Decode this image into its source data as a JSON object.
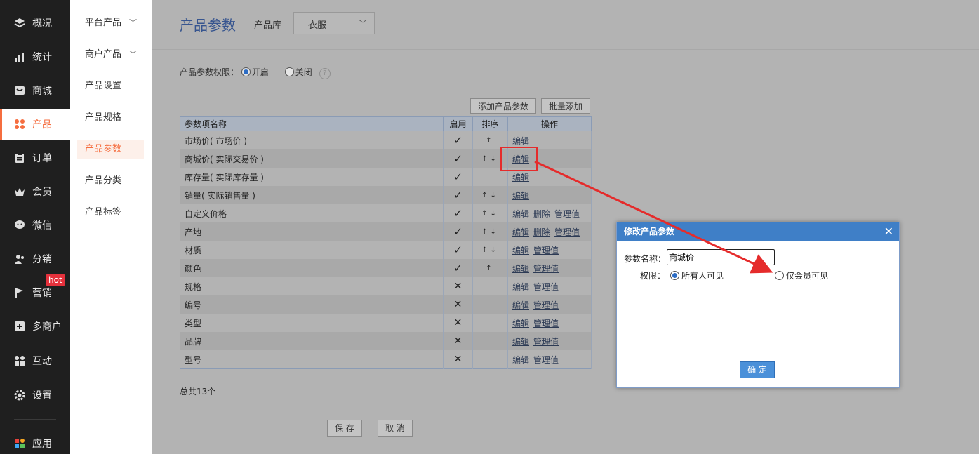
{
  "nav": {
    "items": [
      {
        "label": "概况",
        "icon": "layers-icon"
      },
      {
        "label": "统计",
        "icon": "chart-icon"
      },
      {
        "label": "商城",
        "icon": "store-icon"
      },
      {
        "label": "产品",
        "icon": "grid-icon",
        "active": true
      },
      {
        "label": "订单",
        "icon": "clipboard-icon"
      },
      {
        "label": "会员",
        "icon": "crown-icon"
      },
      {
        "label": "微信",
        "icon": "wechat-icon"
      },
      {
        "label": "分销",
        "icon": "users-icon"
      },
      {
        "label": "营销",
        "icon": "flag-icon"
      },
      {
        "label": "多商户",
        "icon": "merchant-icon"
      },
      {
        "label": "互动",
        "icon": "interact-icon"
      },
      {
        "label": "设置",
        "icon": "gear-icon"
      },
      {
        "label": "应用",
        "icon": "apps-icon"
      }
    ],
    "hot_badge": "hot"
  },
  "subnav": {
    "items": [
      {
        "label": "平台产品",
        "chevron": "﹀"
      },
      {
        "label": "商户产品",
        "chevron": "﹀"
      },
      {
        "label": "产品设置"
      },
      {
        "label": "产品规格"
      },
      {
        "label": "产品参数",
        "active": true
      },
      {
        "label": "产品分类"
      },
      {
        "label": "产品标签"
      }
    ]
  },
  "header": {
    "title": "产品参数",
    "library_label": "产品库",
    "library_value": "衣服",
    "library_arrow": "﹀"
  },
  "permission": {
    "label": "产品参数权限：",
    "on": "开启",
    "off": "关闭",
    "help": "?"
  },
  "toolbar": {
    "add": "添加产品参数",
    "batch": "批量添加"
  },
  "table": {
    "headers": [
      "参数项名称",
      "启用",
      "排序",
      "操作"
    ],
    "rows": [
      {
        "name": "市场价( 市场价 )",
        "enabled": true,
        "sort": "↑",
        "ops": [
          "编辑"
        ]
      },
      {
        "name": "商城价( 实际交易价 )",
        "enabled": true,
        "sort": "↑↓",
        "ops": [
          "编辑"
        ]
      },
      {
        "name": "库存量( 实际库存量 )",
        "enabled": true,
        "sort": "",
        "ops": [
          "编辑"
        ]
      },
      {
        "name": "销量( 实际销售量 )",
        "enabled": true,
        "sort": "↑↓",
        "ops": [
          "编辑"
        ]
      },
      {
        "name": "自定义价格",
        "enabled": true,
        "sort": "↑↓",
        "ops": [
          "编辑",
          "删除",
          "管理值"
        ]
      },
      {
        "name": "产地",
        "enabled": true,
        "sort": "↑↓",
        "ops": [
          "编辑",
          "删除",
          "管理值"
        ]
      },
      {
        "name": "材质",
        "enabled": true,
        "sort": "↑↓",
        "ops": [
          "编辑",
          "管理值"
        ]
      },
      {
        "name": "颜色",
        "enabled": true,
        "sort": "↑",
        "ops": [
          "编辑",
          "管理值"
        ]
      },
      {
        "name": "规格",
        "enabled": false,
        "sort": "",
        "ops": [
          "编辑",
          "管理值"
        ]
      },
      {
        "name": "编号",
        "enabled": false,
        "sort": "",
        "ops": [
          "编辑",
          "管理值"
        ]
      },
      {
        "name": "类型",
        "enabled": false,
        "sort": "",
        "ops": [
          "编辑",
          "管理值"
        ]
      },
      {
        "name": "品牌",
        "enabled": false,
        "sort": "",
        "ops": [
          "编辑",
          "管理值"
        ]
      },
      {
        "name": "型号",
        "enabled": false,
        "sort": "",
        "ops": [
          "编辑",
          "管理值"
        ]
      }
    ],
    "check_glyph": "✓",
    "cross_glyph": "✕"
  },
  "footer": {
    "total": "总共13个",
    "save": "保 存",
    "cancel": "取 消"
  },
  "dialog": {
    "title": "修改产品参数",
    "close": "✕",
    "name_label": "参数名称：",
    "name_value": "商城价",
    "perm_label": "权限：",
    "opt_all": "所有人可见",
    "opt_member": "仅会员可见",
    "ok": "确 定"
  },
  "colors": {
    "accent": "#f56d3f",
    "annotation": "#e52b2b",
    "dialog_header": "#3f7fc7"
  }
}
